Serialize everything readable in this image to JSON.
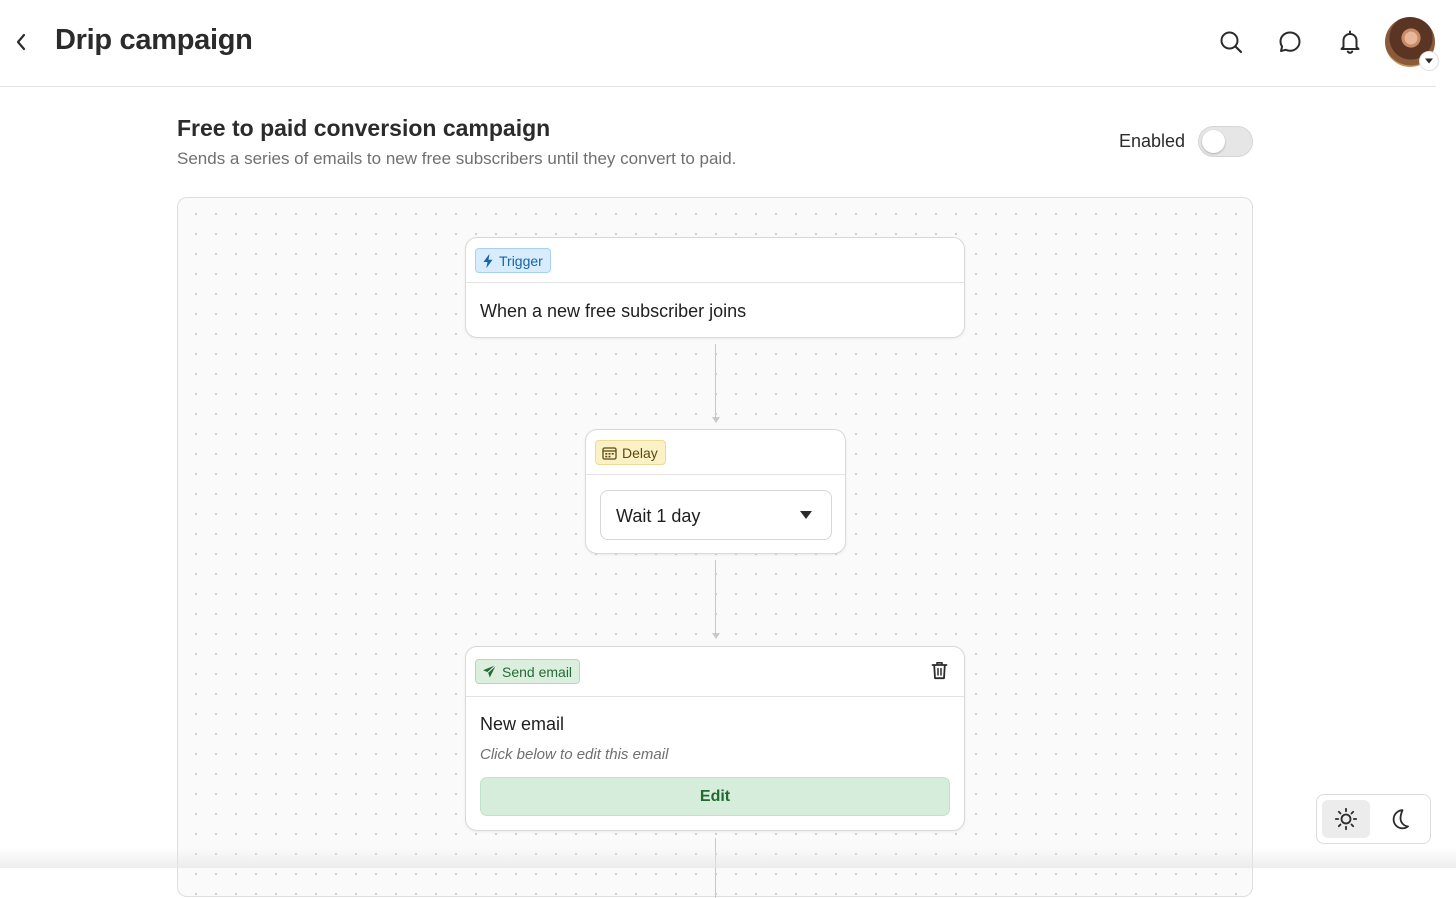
{
  "header": {
    "title": "Drip campaign",
    "icons": [
      "chevron-left-icon",
      "search-icon",
      "chat-icon",
      "bell-icon",
      "caret-down-icon"
    ]
  },
  "campaign": {
    "title": "Free to paid conversion campaign",
    "description": "Sends a series of emails to new free subscribers until they convert to paid.",
    "enabled_label": "Enabled",
    "enabled": false
  },
  "flow": {
    "trigger": {
      "badge": "Trigger",
      "text": "When a new free subscriber joins"
    },
    "delay": {
      "badge": "Delay",
      "selected": "Wait 1 day"
    },
    "send_email": {
      "badge": "Send email",
      "title": "New email",
      "hint": "Click below to edit this email",
      "edit_label": "Edit"
    }
  },
  "theme": {
    "options": [
      "light",
      "dark"
    ],
    "active": "light"
  },
  "colors": {
    "trigger_accent": "#1565a8",
    "delay_accent": "#5b4a12",
    "send_accent": "#256b34",
    "edit_button_bg": "#d6eddb"
  }
}
